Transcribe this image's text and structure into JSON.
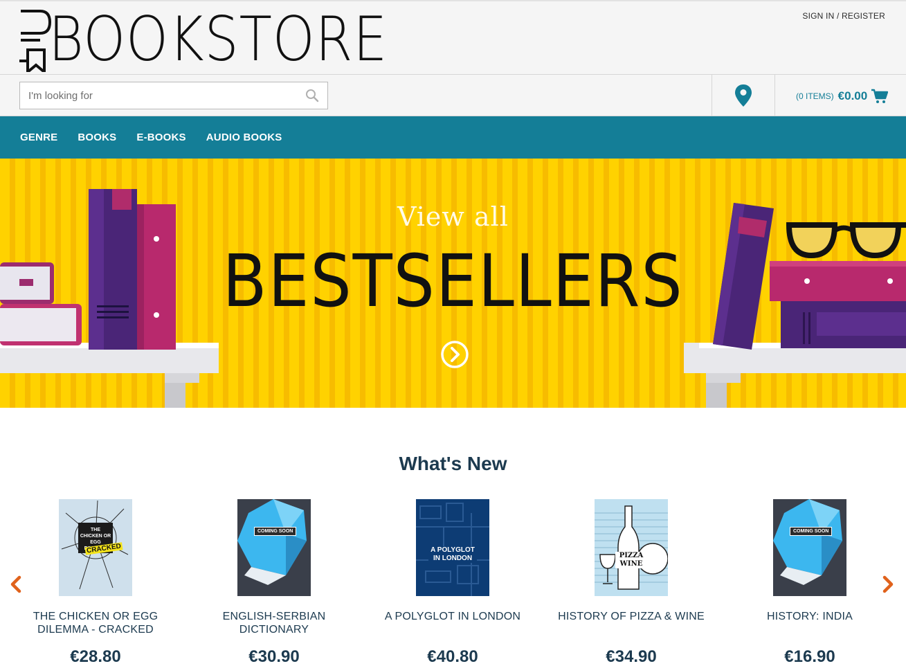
{
  "header": {
    "logo_text": "BOOKSTORE",
    "signin_label": "SIGN IN / REGISTER"
  },
  "search": {
    "placeholder": "I'm looking for",
    "value": ""
  },
  "cart": {
    "items_label": "(0 ITEMS)",
    "total": "€0.00"
  },
  "nav": {
    "items": [
      {
        "label": "GENRE"
      },
      {
        "label": "BOOKS"
      },
      {
        "label": "E-BOOKS"
      },
      {
        "label": "AUDIO BOOKS"
      }
    ]
  },
  "banner": {
    "subtitle": "View all",
    "title": "BESTSELLERS"
  },
  "whats_new": {
    "title": "What's New",
    "products": [
      {
        "title": "THE CHICKEN OR EGG DILEMMA - CRACKED",
        "price": "€28.80",
        "cover_text": "THE CHICKEN OR EGG DILEMMA",
        "cover_badge": "CRACKED"
      },
      {
        "title": "ENGLISH-SERBIAN DICTIONARY",
        "price": "€30.90",
        "cover_badge": "COMING SOON"
      },
      {
        "title": "A POLYGLOT IN LONDON",
        "price": "€40.80",
        "cover_text": "A POLYGLOT IN LONDON"
      },
      {
        "title": "HISTORY OF PIZZA & WINE",
        "price": "€34.90",
        "cover_text": "PIZZA WINE"
      },
      {
        "title": "HISTORY: INDIA",
        "price": "€16.90",
        "cover_badge": "COMING SOON"
      }
    ]
  },
  "colors": {
    "brand_teal": "#147e97",
    "banner_yellow": "#ffd200",
    "carousel_arrow": "#e0621c",
    "text_dark": "#1c3a4f"
  },
  "icons": [
    "bookmark-logo-icon",
    "search-icon",
    "location-pin-icon",
    "cart-icon",
    "chevron-circle-right-icon",
    "chevron-left-icon",
    "chevron-right-icon"
  ]
}
